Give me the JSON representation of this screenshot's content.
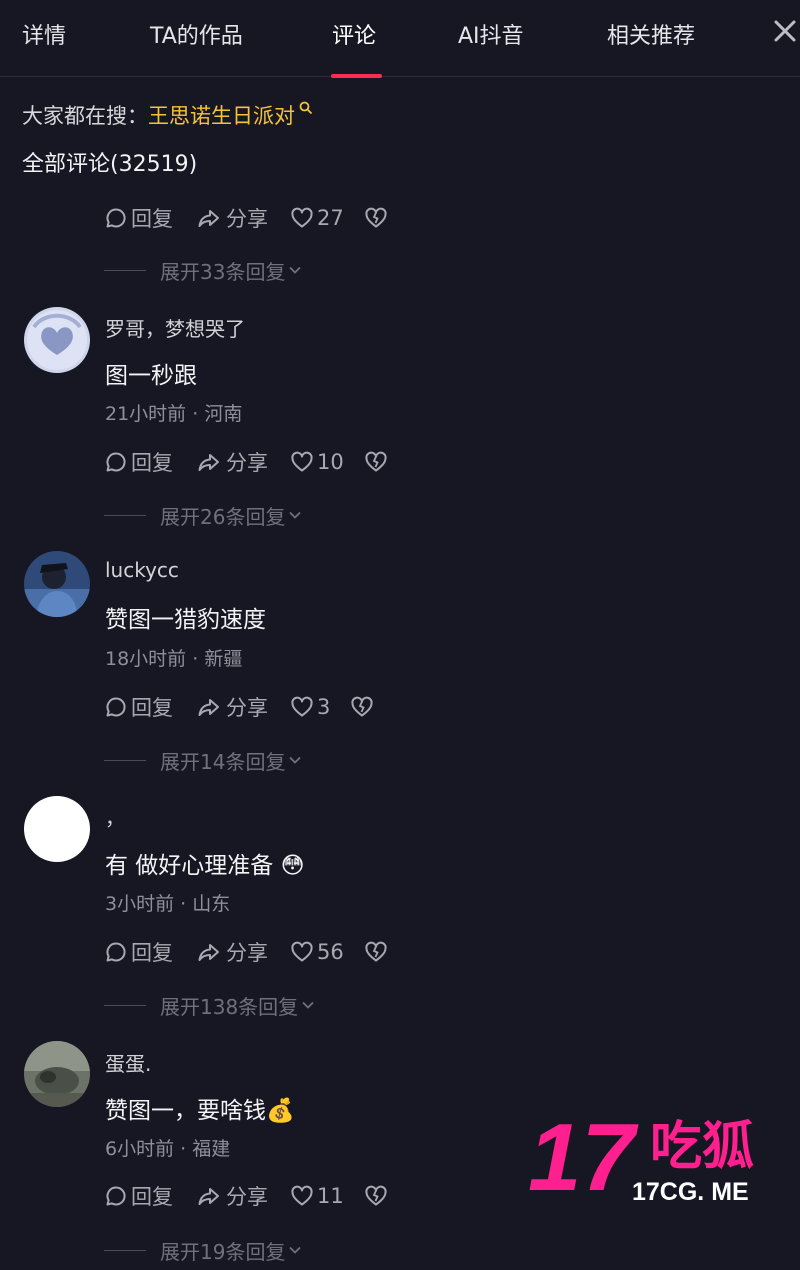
{
  "tabs": [
    {
      "label": "详情"
    },
    {
      "label": "TA的作品"
    },
    {
      "label": "评论"
    },
    {
      "label": "AI抖音"
    },
    {
      "label": "相关推荐"
    }
  ],
  "active_tab": "评论",
  "search": {
    "prefix": "大家都在搜：",
    "keyword": "王思诺生日派对"
  },
  "comment_count_label": "全部评论(32519)",
  "action_labels": {
    "reply": "回复",
    "share": "分享"
  },
  "top_item": {
    "likes": "27",
    "expand": "展开33条回复"
  },
  "comments": [
    {
      "username": "罗哥，梦想哭了",
      "text": "图一秒跟",
      "time": "21小时前",
      "location": "河南",
      "likes": "10",
      "expand": "展开26条回复"
    },
    {
      "username": "luckycc",
      "text": "赞图一猎豹速度",
      "time": "18小时前",
      "location": "新疆",
      "likes": "3",
      "expand": "展开14条回复"
    },
    {
      "username": "，",
      "text": "有 做好心理准备",
      "emoji": "😳",
      "time": "3小时前",
      "location": "山东",
      "likes": "56",
      "expand": "展开138条回复"
    },
    {
      "username": "蛋蛋.",
      "text": "赞图一，要啥钱",
      "emoji": "💰",
      "time": "6小时前",
      "location": "福建",
      "likes": "11",
      "expand": "展开19条回复"
    }
  ],
  "meta_separator": " · ",
  "watermark": {
    "big": "17",
    "cn": "吃狐",
    "small": "17CG. ME"
  },
  "colors": {
    "background": "#161722",
    "accent": "#fe2c55",
    "keyword": "#f5c43a",
    "watermark": "#ff1f8e"
  }
}
